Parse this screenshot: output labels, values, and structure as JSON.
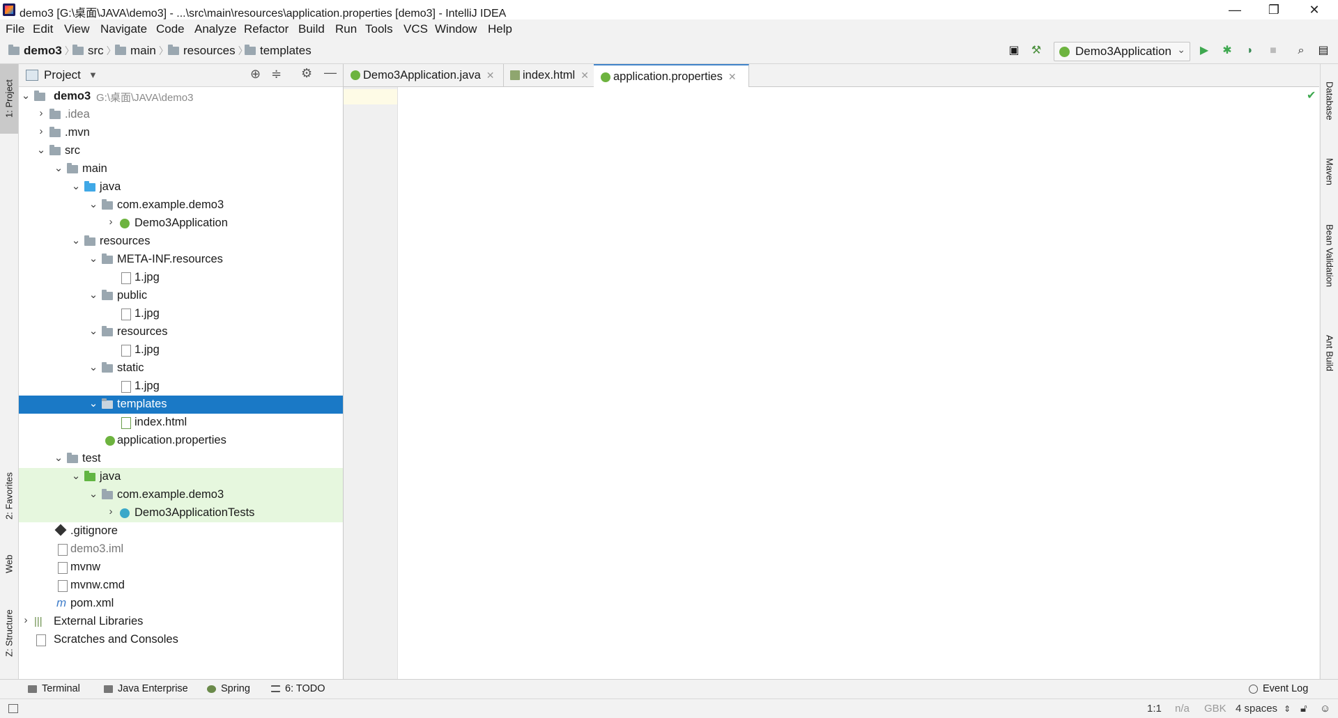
{
  "window": {
    "title": "demo3 [G:\\桌面\\JAVA\\demo3] - ...\\src\\main\\resources\\application.properties [demo3] - IntelliJ IDEA",
    "minimize": "—",
    "restore": "❐",
    "close": "✕"
  },
  "menu": [
    "File",
    "Edit",
    "View",
    "Navigate",
    "Code",
    "Analyze",
    "Refactor",
    "Build",
    "Run",
    "Tools",
    "VCS",
    "Window",
    "Help"
  ],
  "breadcrumb": [
    "demo3",
    "src",
    "main",
    "resources",
    "templates"
  ],
  "toolbar": {
    "run_config": "Demo3Application"
  },
  "left_tabs": {
    "project": "1: Project",
    "favorites": "2: Favorites",
    "web": "Web",
    "structure": "Z: Structure"
  },
  "right_tabs": {
    "database": "Database",
    "maven": "Maven",
    "bean_validation": "Bean Validation",
    "ant_build": "Ant Build"
  },
  "project_panel": {
    "title": "Project",
    "tree": [
      {
        "label": "demo3",
        "hint": "G:\\桌面\\JAVA\\demo3"
      },
      {
        "label": ".idea"
      },
      {
        "label": ".mvn"
      },
      {
        "label": "src"
      },
      {
        "label": "main"
      },
      {
        "label": "java"
      },
      {
        "label": "com.example.demo3"
      },
      {
        "label": "Demo3Application"
      },
      {
        "label": "resources"
      },
      {
        "label": "META-INF.resources"
      },
      {
        "label": "1.jpg"
      },
      {
        "label": "public"
      },
      {
        "label": "1.jpg"
      },
      {
        "label": "resources"
      },
      {
        "label": "1.jpg"
      },
      {
        "label": "static"
      },
      {
        "label": "1.jpg"
      },
      {
        "label": "templates"
      },
      {
        "label": "index.html"
      },
      {
        "label": "application.properties"
      },
      {
        "label": "test"
      },
      {
        "label": "java"
      },
      {
        "label": "com.example.demo3"
      },
      {
        "label": "Demo3ApplicationTests"
      },
      {
        "label": ".gitignore"
      },
      {
        "label": "demo3.iml"
      },
      {
        "label": "mvnw"
      },
      {
        "label": "mvnw.cmd"
      },
      {
        "label": "pom.xml"
      },
      {
        "label": "External Libraries"
      },
      {
        "label": "Scratches and Consoles"
      }
    ]
  },
  "editor_tabs": [
    {
      "label": "Demo3Application.java"
    },
    {
      "label": "index.html"
    },
    {
      "label": "application.properties"
    }
  ],
  "bottom_tools": {
    "terminal": "Terminal",
    "java_enterprise": "Java Enterprise",
    "spring": "Spring",
    "todo": "6: TODO",
    "event_log": "Event Log"
  },
  "status": {
    "position": "1:1",
    "na": "n/a",
    "encoding": "GBK",
    "indent": "4 spaces"
  },
  "colors": {
    "selection": "#1a79c6",
    "test_background": "#e6f7de",
    "active_tab_border": "#4083c9"
  }
}
